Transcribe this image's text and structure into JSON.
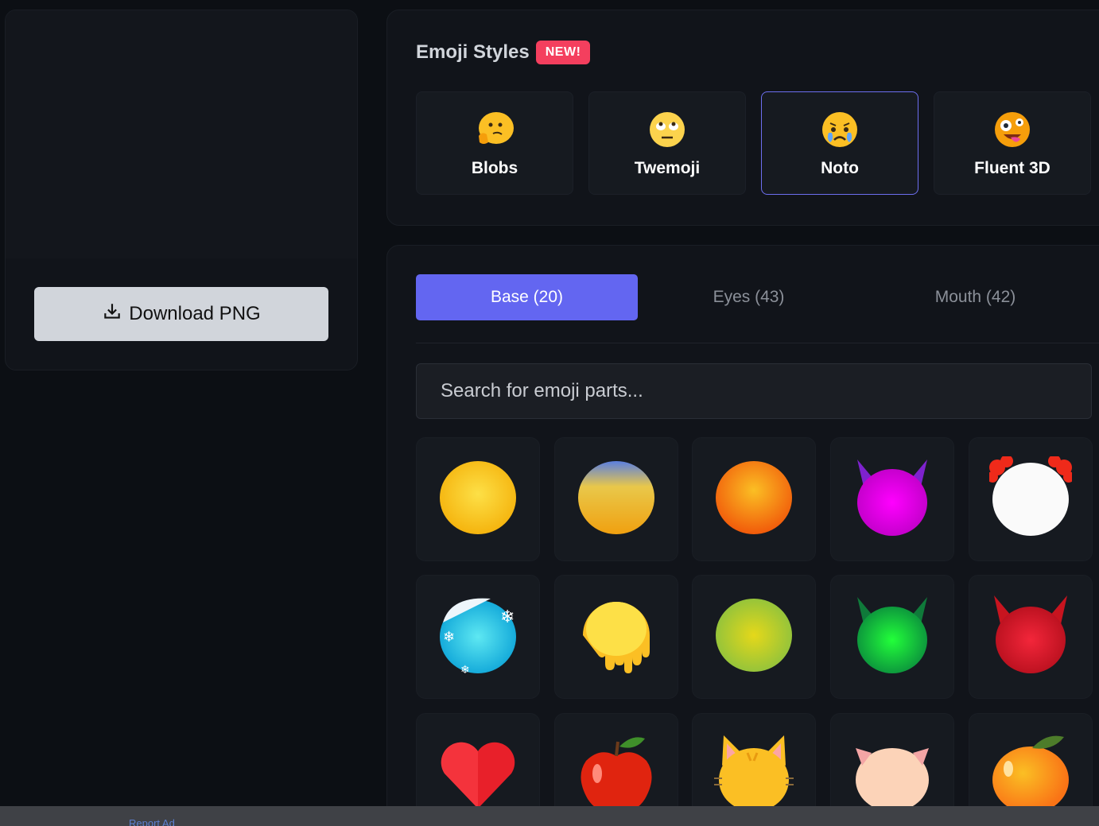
{
  "preview": {
    "download_label": "Download PNG"
  },
  "styles": {
    "title": "Emoji Styles",
    "badge": "NEW!",
    "items": [
      {
        "label": "Blobs",
        "icon": "thinking-face-icon"
      },
      {
        "label": "Twemoji",
        "icon": "face-with-rolling-eyes-icon"
      },
      {
        "label": "Noto",
        "icon": "crying-face-icon",
        "selected": true
      },
      {
        "label": "Fluent 3D",
        "icon": "zany-face-icon"
      }
    ]
  },
  "parts": {
    "tabs": [
      {
        "label": "Base (20)",
        "active": true
      },
      {
        "label": "Eyes (43)",
        "active": false
      },
      {
        "label": "Mouth (42)",
        "active": false
      }
    ],
    "search_placeholder": "Search for emoji parts...",
    "items": [
      "yellow-face-base-icon",
      "sunset-gradient-face-base-icon",
      "orange-face-base-icon",
      "purple-devil-face-base-icon",
      "clown-face-base-icon",
      "cold-face-base-icon",
      "melting-face-base-icon",
      "green-yellow-face-base-icon",
      "green-devil-face-base-icon",
      "red-devil-face-base-icon",
      "heart-base-icon",
      "apple-base-icon",
      "cat-face-base-icon",
      "pig-face-base-icon",
      "tangerine-base-icon"
    ]
  },
  "footer": {
    "report_ad": "Report Ad"
  },
  "colors": {
    "accent": "#6366f1",
    "badge": "#f43f5e",
    "background": "#0c0f14"
  }
}
